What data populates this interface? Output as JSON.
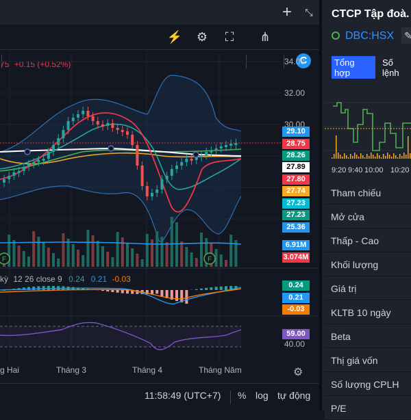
{
  "chart": {
    "legend_price": "75",
    "legend_change": "+0.15 (+0.52%)",
    "price_axis": [
      "34.00",
      "32.00",
      "30.00"
    ],
    "price_tags": [
      {
        "value": "29.10",
        "color": "#2196f3"
      },
      {
        "value": "28.75",
        "color": "#f23645"
      },
      {
        "value": "28.26",
        "color": "#089981"
      },
      {
        "value": "27.89",
        "color": "#ffffff",
        "text": "#000000"
      },
      {
        "value": "27.80",
        "color": "#f23645"
      },
      {
        "value": "27.74",
        "color": "#f9a825"
      },
      {
        "value": "27.23",
        "color": "#00bcd4"
      },
      {
        "value": "27.23",
        "color": "#089981"
      },
      {
        "value": "25.36",
        "color": "#2196f3"
      }
    ],
    "volume_tags": [
      {
        "value": "6.91M",
        "color": "#2196f3"
      },
      {
        "value": "3.074M",
        "color": "#f23645"
      }
    ],
    "macd_legend": {
      "prefix": "kỳ",
      "params": "12 26 close 9",
      "v1": "0.24",
      "v2": "0.21",
      "v3": "-0.03"
    },
    "macd_tags": [
      {
        "value": "0.24",
        "color": "#089981"
      },
      {
        "value": "0.21",
        "color": "#2196f3"
      },
      {
        "value": "-0.03",
        "color": "#f57c00"
      }
    ],
    "rsi_tags": [
      {
        "value": "59.00",
        "color": "#7e57c2"
      }
    ],
    "rsi_axis_low": "40.00",
    "time_labels": [
      "g Hai",
      "Tháng 3",
      "Tháng 4",
      "Tháng Năm"
    ],
    "event_marker": "F"
  },
  "bottom": {
    "clock": "11:58:49 (UTC+7)",
    "percent": "%",
    "log": "log",
    "auto": "tự động"
  },
  "side": {
    "title": "CTCP Tập đoà.",
    "symbol": "DBC:HSX",
    "tabs": [
      "Tổng hợp",
      "Số lệnh"
    ],
    "time_labels": [
      "9:20",
      "9:40",
      "10:00",
      "10:20"
    ],
    "rows": [
      "Tham chiếu",
      "Mở cửa",
      "Thấp - Cao",
      "Khối lượng",
      "Giá trị",
      "KLTB 10 ngày",
      "Beta",
      "Thị giá vốn",
      "Số lượng CPLH",
      "P/E"
    ]
  }
}
